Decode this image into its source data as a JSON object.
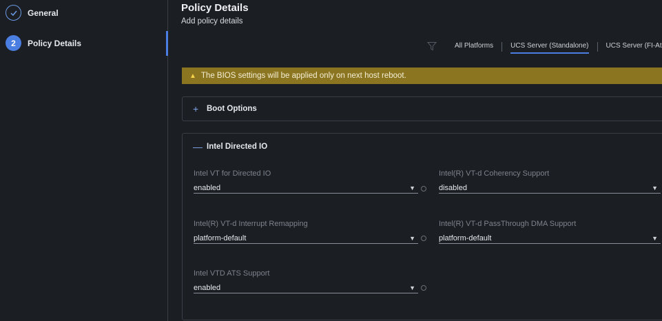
{
  "steps": [
    {
      "number": "",
      "label": "General",
      "state": "done"
    },
    {
      "number": "2",
      "label": "Policy Details",
      "state": "active"
    }
  ],
  "header": {
    "title": "Policy Details",
    "subtitle": "Add policy details"
  },
  "platform_tabs": [
    {
      "label": "All Platforms",
      "active": false
    },
    {
      "label": "UCS Server (Standalone)",
      "active": true
    },
    {
      "label": "UCS Server (FI-At",
      "active": false
    }
  ],
  "banner": {
    "icon": "warning-icon",
    "text": "The BIOS settings will be applied only on next host reboot."
  },
  "sections": {
    "boot": {
      "title": "Boot Options",
      "expanded": false
    },
    "intel": {
      "title": "Intel Directed IO",
      "expanded": true,
      "fields": [
        {
          "label": "Intel VT for Directed IO",
          "value": "enabled"
        },
        {
          "label": "Intel(R) VT-d Coherency Support",
          "value": "disabled"
        },
        {
          "label": "Intel(R) VT-d Interrupt Remapping",
          "value": "platform-default"
        },
        {
          "label": "Intel(R) VT-d PassThrough DMA Support",
          "value": "platform-default"
        },
        {
          "label": "Intel VTD ATS Support",
          "value": "enabled"
        }
      ]
    }
  },
  "colors": {
    "accent": "#4a7ee0",
    "banner_bg": "#8b7520",
    "background": "#1b1e23"
  }
}
